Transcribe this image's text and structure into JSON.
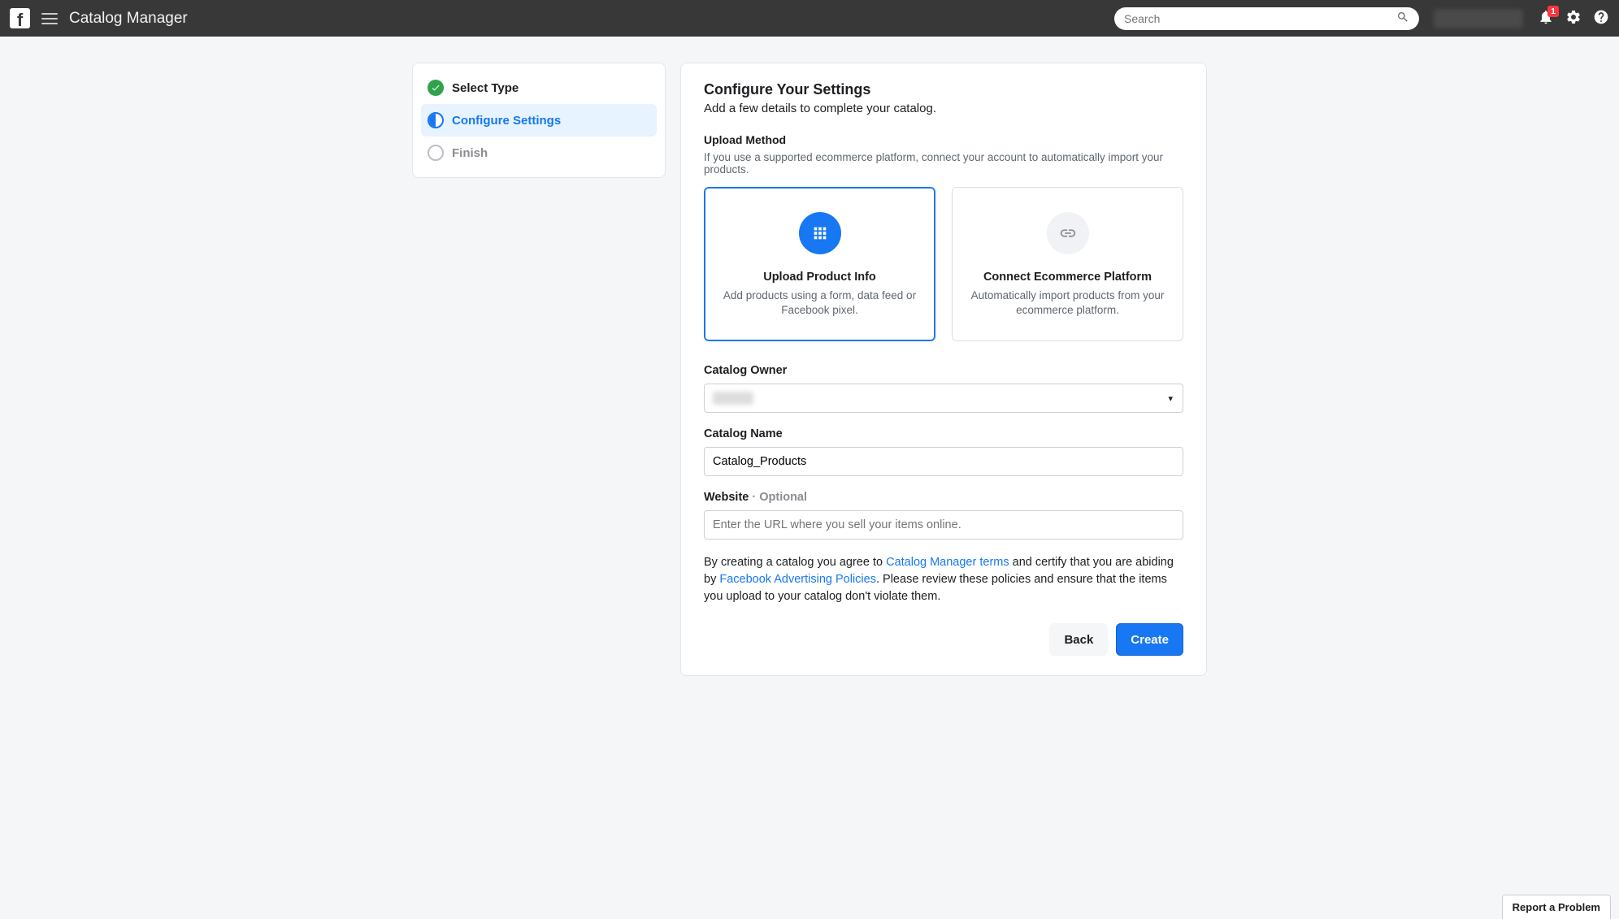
{
  "header": {
    "app_title": "Catalog Manager",
    "search_placeholder": "Search",
    "notifications_count": "1"
  },
  "sidebar": {
    "steps": [
      {
        "label": "Select Type",
        "state": "completed"
      },
      {
        "label": "Configure Settings",
        "state": "active"
      },
      {
        "label": "Finish",
        "state": "pending"
      }
    ]
  },
  "main": {
    "title": "Configure Your Settings",
    "subtitle": "Add a few details to complete your catalog.",
    "upload_method": {
      "label": "Upload Method",
      "help": "If you use a supported ecommerce platform, connect your account to automatically import your products.",
      "cards": [
        {
          "title": "Upload Product Info",
          "desc": "Add products using a form, data feed or Facebook pixel.",
          "selected": true,
          "icon": "grid-icon"
        },
        {
          "title": "Connect Ecommerce Platform",
          "desc": "Automatically import products from your ecommerce platform.",
          "selected": false,
          "icon": "link-icon"
        }
      ]
    },
    "owner": {
      "label": "Catalog Owner"
    },
    "name": {
      "label": "Catalog Name",
      "value": "Catalog_Products"
    },
    "website": {
      "label": "Website",
      "optional": " · Optional",
      "placeholder": "Enter the URL where you sell your items online."
    },
    "terms": {
      "prefix": "By creating a catalog you agree to ",
      "link1": "Catalog Manager terms",
      "mid": " and certify that you are abiding by ",
      "link2": "Facebook Advertising Policies",
      "suffix": ". Please review these policies and ensure that the items you upload to your catalog don't violate them."
    },
    "buttons": {
      "back": "Back",
      "create": "Create"
    }
  },
  "footer": {
    "report": "Report a Problem"
  }
}
